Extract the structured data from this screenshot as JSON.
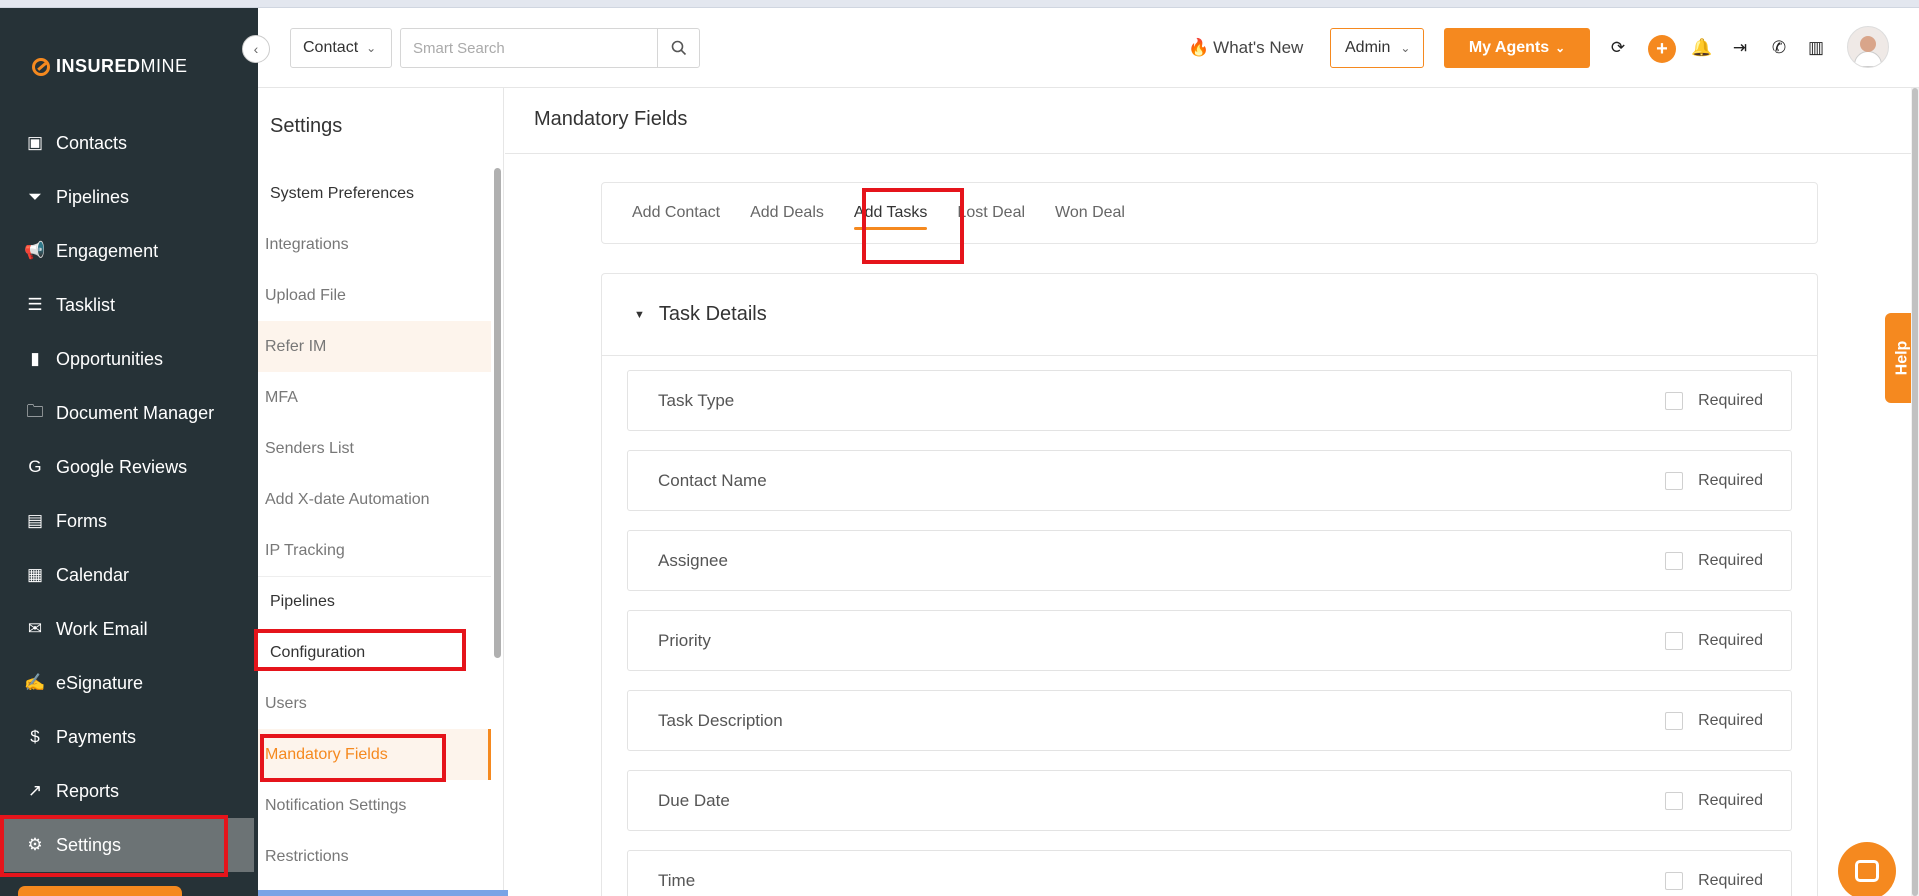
{
  "brand": {
    "logo_bold": "INSURED",
    "logo_light": "MINE"
  },
  "sidebar": {
    "items": [
      {
        "label": "Contacts",
        "icon": "contacts-icon",
        "glyph": "▣"
      },
      {
        "label": "Pipelines",
        "icon": "filter-icon",
        "glyph": "⏷"
      },
      {
        "label": "Engagement",
        "icon": "megaphone-icon",
        "glyph": "📢"
      },
      {
        "label": "Tasklist",
        "icon": "clipboard-icon",
        "glyph": "☰"
      },
      {
        "label": "Opportunities",
        "icon": "bar-chart-icon",
        "glyph": "▮"
      },
      {
        "label": "Document Manager",
        "icon": "folder-icon",
        "glyph": "🗀"
      },
      {
        "label": "Google Reviews",
        "icon": "google-icon",
        "glyph": "G"
      },
      {
        "label": "Forms",
        "icon": "form-icon",
        "glyph": "▤"
      },
      {
        "label": "Calendar",
        "icon": "calendar-icon",
        "glyph": "▦"
      },
      {
        "label": "Work Email",
        "icon": "envelope-icon",
        "glyph": "✉"
      },
      {
        "label": "eSignature",
        "icon": "signature-icon",
        "glyph": "✍"
      },
      {
        "label": "Payments",
        "icon": "dollar-icon",
        "glyph": "$"
      },
      {
        "label": "Reports",
        "icon": "line-chart-icon",
        "glyph": "↗"
      },
      {
        "label": "Settings",
        "icon": "gear-icon",
        "glyph": "⚙"
      }
    ]
  },
  "header": {
    "contact_select": "Contact",
    "search_placeholder": "Smart Search",
    "whats_new": "What's New",
    "admin_select": "Admin",
    "my_agents": "My Agents"
  },
  "settings": {
    "title": "Settings",
    "items": [
      {
        "label": "System Preferences",
        "type": "group"
      },
      {
        "label": "Integrations",
        "type": "item"
      },
      {
        "label": "Upload File",
        "type": "item"
      },
      {
        "label": "Refer IM",
        "type": "highlight"
      },
      {
        "label": "MFA",
        "type": "item"
      },
      {
        "label": "Senders List",
        "type": "item"
      },
      {
        "label": "Add X-date Automation",
        "type": "item"
      },
      {
        "label": "IP Tracking",
        "type": "item"
      },
      {
        "label": "Pipelines",
        "type": "group"
      },
      {
        "label": "Configuration",
        "type": "group"
      },
      {
        "label": "Users",
        "type": "item"
      },
      {
        "label": "Mandatory Fields",
        "type": "active"
      },
      {
        "label": "Notification Settings",
        "type": "item"
      },
      {
        "label": "Restrictions",
        "type": "item"
      }
    ]
  },
  "main": {
    "title": "Mandatory Fields",
    "tabs": [
      "Add Contact",
      "Add Deals",
      "Add Tasks",
      "Lost Deal",
      "Won Deal"
    ],
    "active_tab": "Add Tasks",
    "section_title": "Task Details",
    "required_label": "Required",
    "fields": [
      "Task Type",
      "Contact Name",
      "Assignee",
      "Priority",
      "Task Description",
      "Due Date",
      "Time"
    ]
  },
  "help": {
    "label": "Help"
  },
  "colors": {
    "accent": "#f5891f",
    "sidebar_bg": "#263237",
    "annotation_red": "#e5141b"
  }
}
